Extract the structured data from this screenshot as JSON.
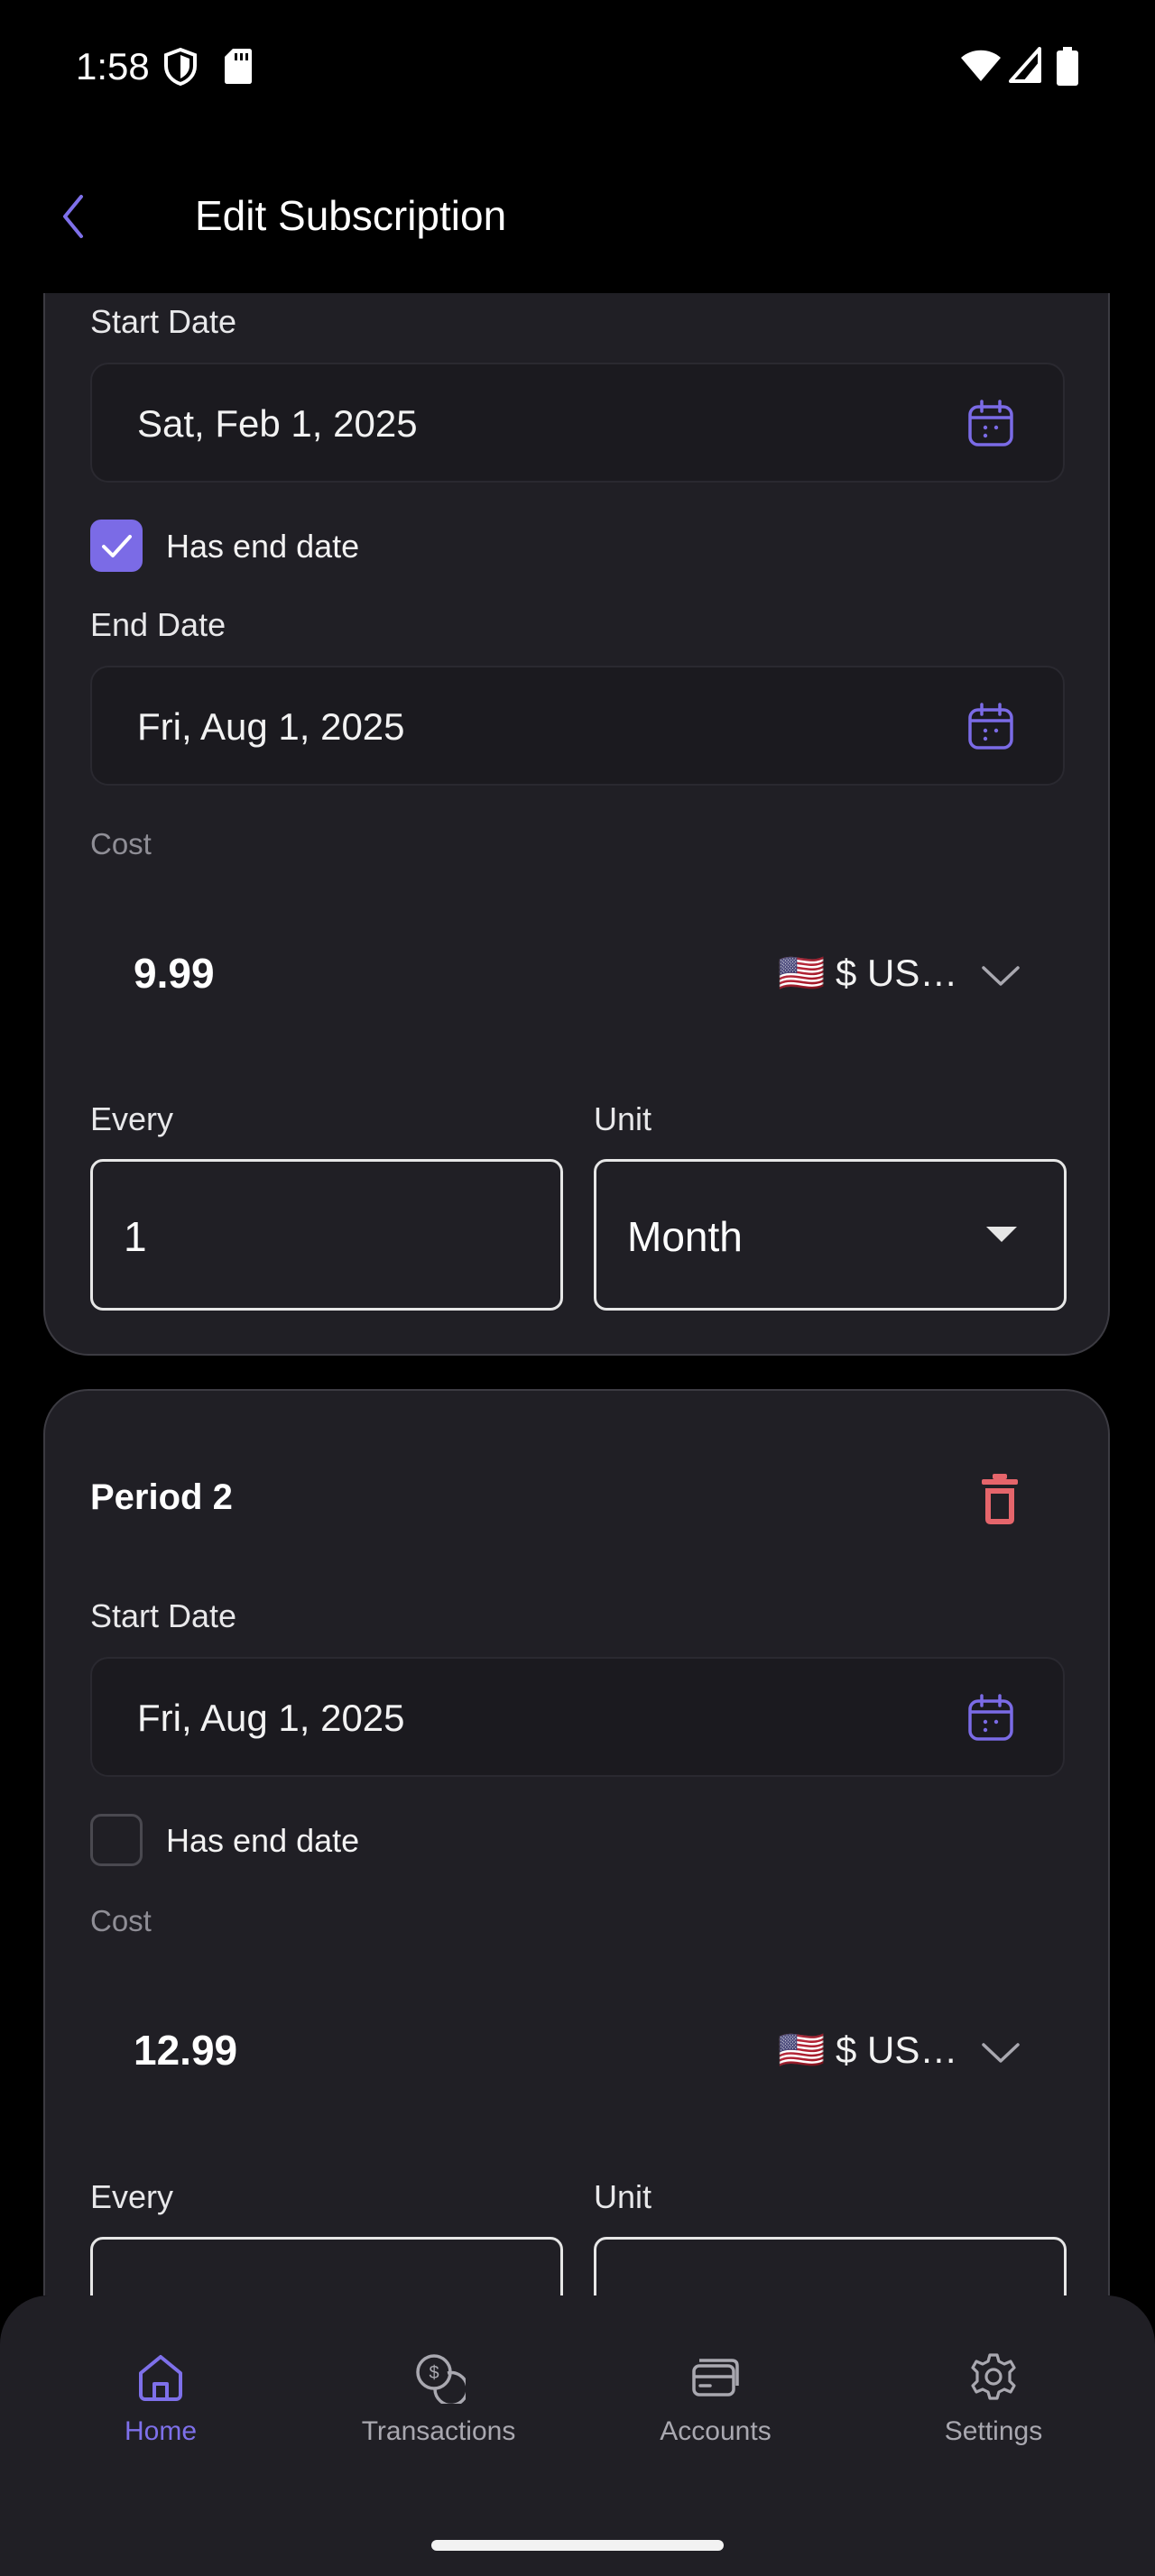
{
  "status_bar": {
    "time": "1:58"
  },
  "app_bar": {
    "title": "Edit Subscription"
  },
  "period1": {
    "start_date_label": "Start Date",
    "start_date": "Sat, Feb 1, 2025",
    "has_end_date_label": "Has end date",
    "has_end_date": true,
    "end_date_label": "End Date",
    "end_date": "Fri, Aug 1, 2025",
    "cost_label": "Cost",
    "cost": "9.99",
    "currency": "🇺🇸 $ US…",
    "every_label": "Every",
    "every": "1",
    "unit_label": "Unit",
    "unit": "Month"
  },
  "period2": {
    "title": "Period 2",
    "start_date_label": "Start Date",
    "start_date": "Fri, Aug 1, 2025",
    "has_end_date_label": "Has end date",
    "has_end_date": false,
    "cost_label": "Cost",
    "cost": "12.99",
    "currency": "🇺🇸 $ US…",
    "every_label": "Every",
    "unit_label": "Unit"
  },
  "nav": {
    "items": [
      {
        "label": "Home",
        "icon": "home-icon",
        "active": true
      },
      {
        "label": "Transactions",
        "icon": "dollar-coins-icon",
        "active": false
      },
      {
        "label": "Accounts",
        "icon": "cards-icon",
        "active": false
      },
      {
        "label": "Settings",
        "icon": "gear-icon",
        "active": false
      }
    ]
  },
  "colors": {
    "accent": "#7b6be6",
    "danger": "#e5656b",
    "card": "#201f25",
    "background": "#000000"
  }
}
